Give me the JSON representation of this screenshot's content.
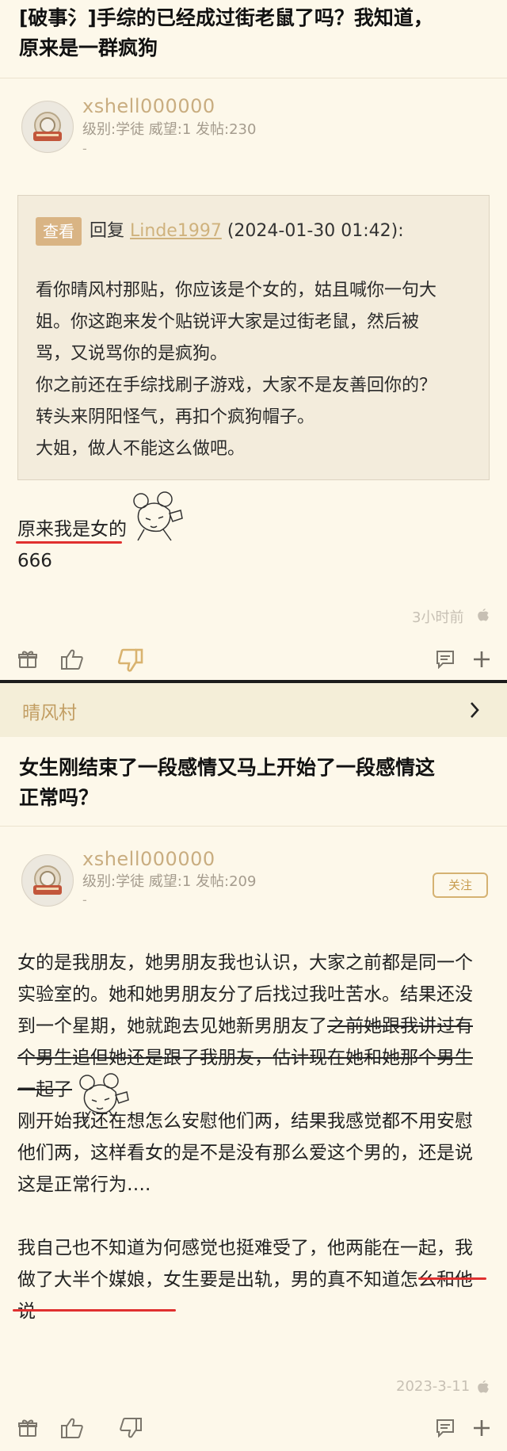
{
  "post1": {
    "title_line1": "[破事氵]手综的已经成过街老鼠了吗？我知道，",
    "title_line2": "原来是一群疯狗",
    "author": {
      "name": "xshell000000",
      "meta": "级别:学徒 威望:1 发帖:230",
      "sub": "-"
    },
    "quote": {
      "badge": "查看",
      "reply_prefix": "回复",
      "reply_user": "Linde1997",
      "reply_time": "(2024-01-30 01:42):",
      "lines": [
        "看你晴风村那贴，你应该是个女的，姑且喊你一句大",
        "姐。你这跑来发个贴锐评大家是过街老鼠，然后被",
        "骂，又说骂你的是疯狗。",
        "你之前还在手综找刷子游戏，大家不是友善回你的？",
        "转头来阴阳怪气，再扣个疯狗帽子。",
        "大姐，做人不能这么做吧。"
      ]
    },
    "reply_line1": "原来我是女的",
    "reply_line2": "666",
    "time": "3小时前"
  },
  "section": {
    "label": "晴风村",
    "chevron": "›"
  },
  "post2": {
    "title_line1": "女生刚结束了一段感情又马上开始了一段感情这",
    "title_line2": "正常吗？",
    "author": {
      "name": "xshell000000",
      "meta": "级别:学徒 威望:1 发帖:209",
      "sub": "-"
    },
    "follow_label": "关注",
    "body": {
      "l1": "女的是我朋友，她男朋友我也认识，大家之前都是同一个",
      "l2": "实验室的。她和她男朋友分了后找过我吐苦水。结果还没",
      "l3_normal": "到一个星期，她就跑去见她新男朋友了",
      "l3_strike": "之前她跟我讲过有",
      "l4_strike": "个男生追但她还是跟了我朋友，估计现在她和她那个男生",
      "l5_strike": "一起了",
      "l6": "刚开始我还在想怎么安慰他们两，结果我感觉都不用安慰",
      "l7": "他们两，这样看女的是不是没有那么爱这个男的，还是说",
      "l8": "这是正常行为….",
      "l9": "我自己也不知道为何感觉也挺难受了，他两能在一起，我",
      "l10": "做了大半个媒娘，女生要是出轨，男的真不知道怎么和他",
      "l11": "说"
    },
    "time": "2023-3-11"
  },
  "icons": {
    "avatar": "avatar-icon",
    "apple": "apple-icon",
    "gift": "gift-icon",
    "like": "thumbs-up-icon",
    "dislike": "thumbs-down-icon",
    "comment": "comment-icon",
    "add": "plus-icon",
    "chevron": "chevron-right-icon"
  },
  "colors": {
    "background": "#fdf8ea",
    "username": "#c9ad80",
    "quote_bg": "#f3ecdc",
    "badge": "#d9b484",
    "section_bg": "#f4eed8",
    "section_label": "#c29e63",
    "underline": "#e0302f"
  }
}
